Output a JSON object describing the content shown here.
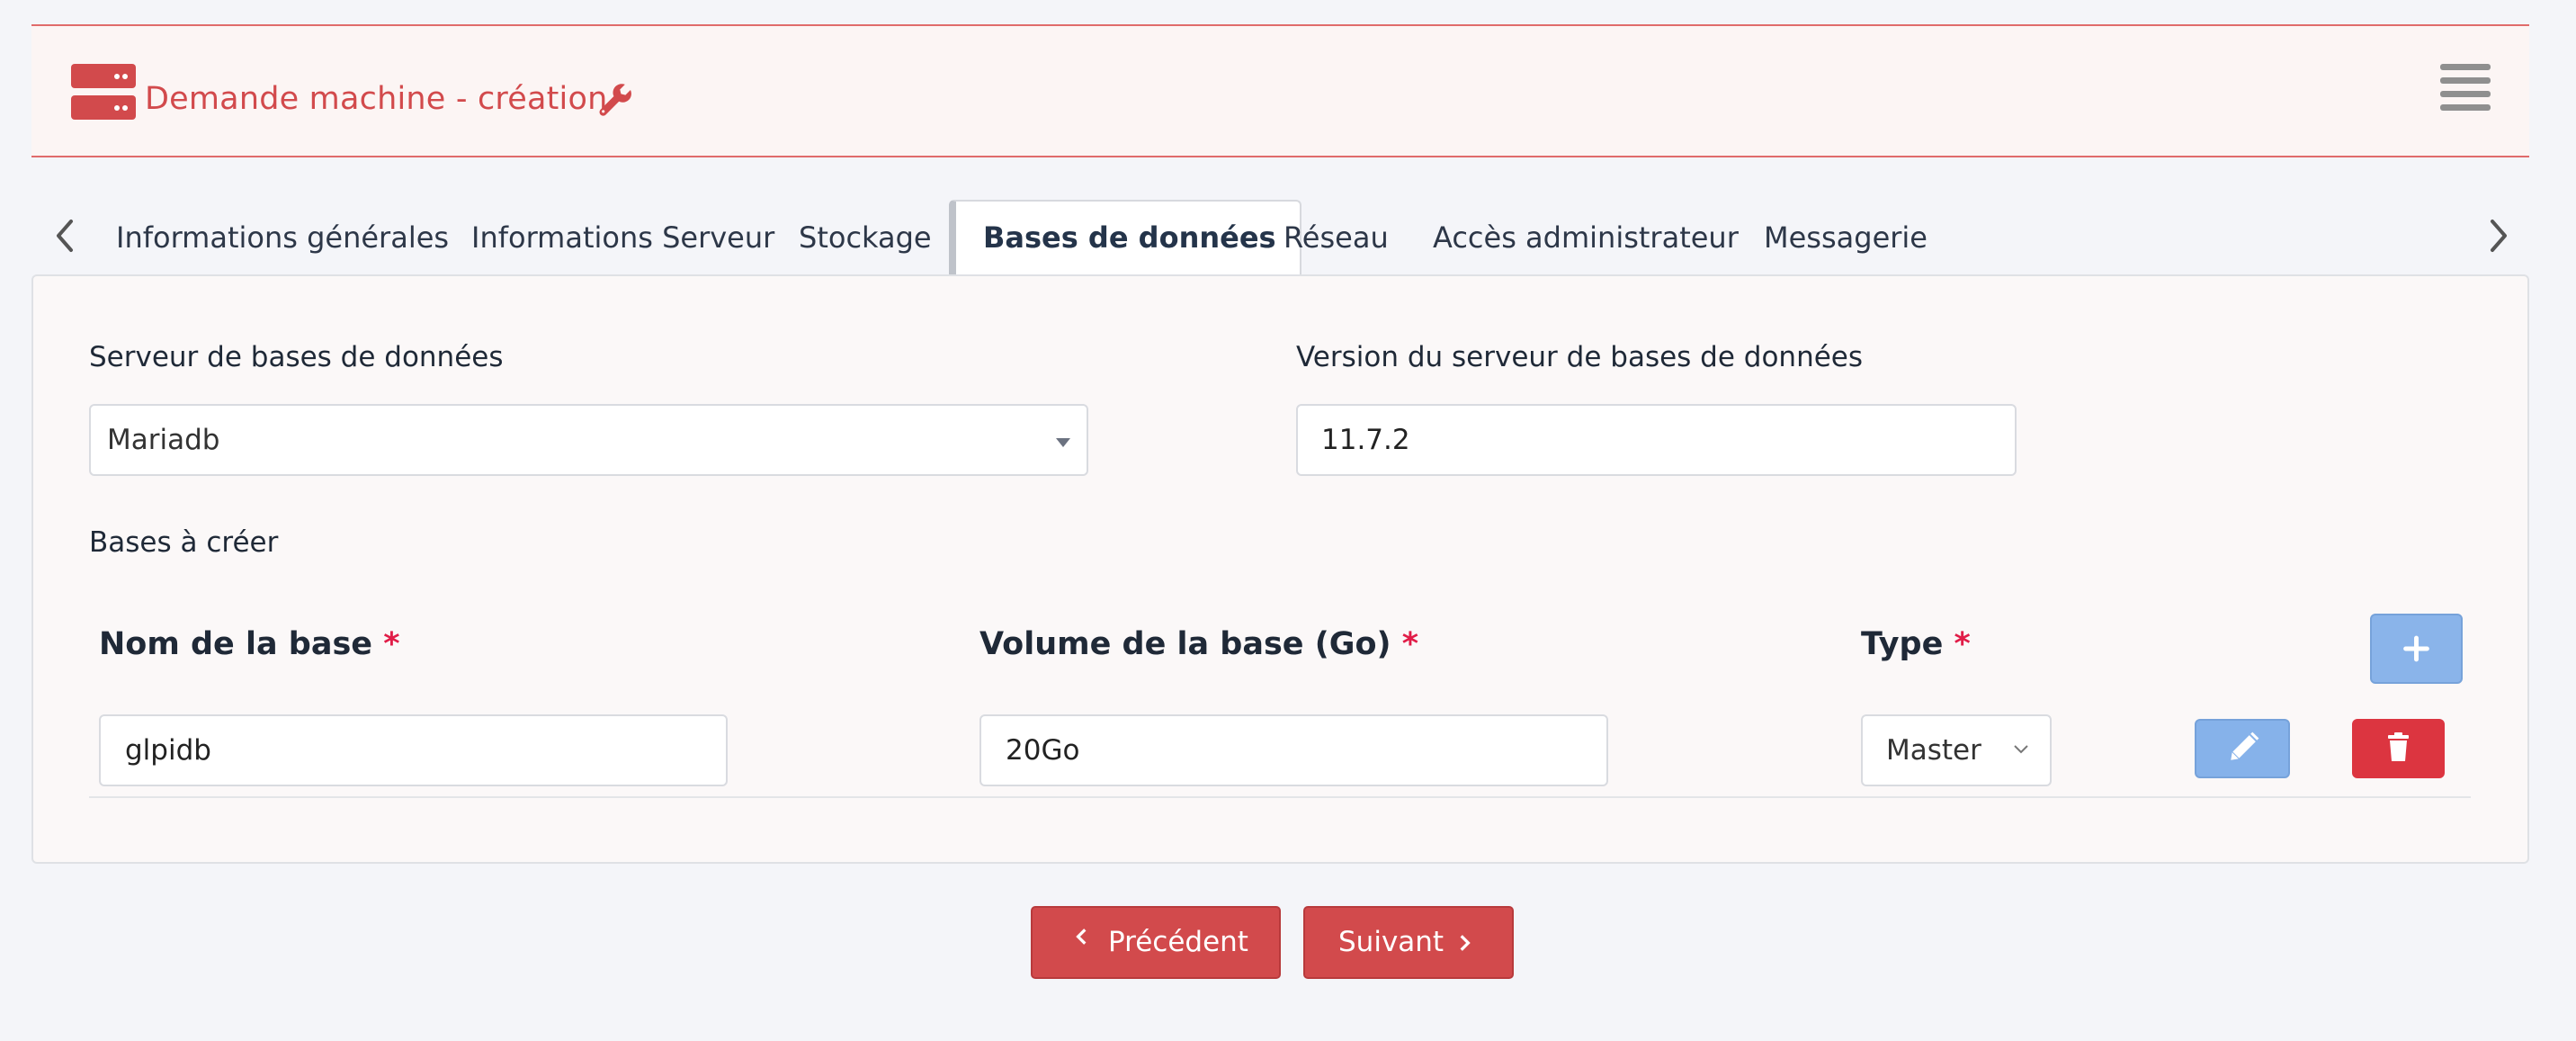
{
  "header": {
    "title": "Demande machine - création"
  },
  "tabs": [
    {
      "label": "Informations générales"
    },
    {
      "label": "Informations Serveur"
    },
    {
      "label": "Stockage"
    },
    {
      "label": "Bases de données",
      "active": true
    },
    {
      "label": "Réseau"
    },
    {
      "label": "Accès administrateur"
    },
    {
      "label": "Messagerie"
    }
  ],
  "form": {
    "db_server_label": "Serveur de bases de données",
    "db_server_value": "Mariadb",
    "db_version_label": "Version du serveur de bases de données",
    "db_version_value": "11.7.2",
    "bases_label": "Bases à créer"
  },
  "table": {
    "headers": {
      "name": "Nom de la base",
      "volume": "Volume de la base (Go)",
      "type": "Type",
      "required_mark": "*"
    },
    "rows": [
      {
        "name": "glpidb",
        "volume": "20Go",
        "type": "Master"
      }
    ]
  },
  "nav": {
    "prev_label": "Précédent",
    "next_label": "Suivant"
  },
  "colors": {
    "accent": "#d24a4c",
    "edit_blue": "#86b2ea",
    "delete_red": "#dc3540"
  },
  "icons": [
    "server-icon",
    "wrench-icon",
    "hamburger-menu-icon",
    "chevron-left-icon",
    "chevron-right-icon",
    "plus-icon",
    "pencil-icon",
    "trash-icon",
    "chevron-down-icon"
  ]
}
